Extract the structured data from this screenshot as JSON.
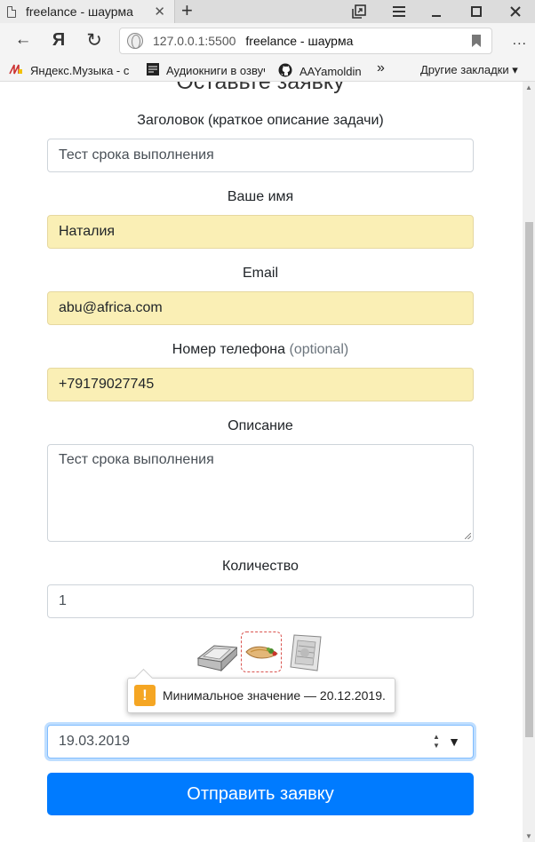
{
  "browser": {
    "tab_title": "freelance - шаурма",
    "new_tab": "+",
    "url": "127.0.0.1:5500",
    "page_title": "freelance - шаурма",
    "back": "←",
    "yandex": "Я",
    "reload": "↻",
    "menu": "..."
  },
  "bookmarks": {
    "items": [
      {
        "label": "Яндекс.Музыка - с",
        "icon": "yandex-music-icon"
      },
      {
        "label": "Аудиокниги в озвуч",
        "icon": "audiobooks-icon"
      },
      {
        "label": "AAYamoldin",
        "icon": "github-icon"
      }
    ],
    "more": "»",
    "other": "Другие закладки ▾"
  },
  "form": {
    "heading": "Оставьте заявку",
    "title_label": "Заголовок (краткое описание задачи)",
    "title_value": "Тест срока выполнения",
    "name_label": "Ваше имя",
    "name_value": "Наталия",
    "email_label": "Email",
    "email_value": "abu@africa.com",
    "phone_label": "Номер телефона",
    "phone_optional": "(optional)",
    "phone_value": "+79179027745",
    "description_label": "Описание",
    "description_value": "Тест срока выполнения",
    "quantity_label": "Количество",
    "quantity_value": "1",
    "products": [
      "container-icon",
      "shawarma-icon",
      "foil-wrap-icon"
    ],
    "selected_product": "shawarma-icon",
    "date_value": "19.03.2019",
    "submit_label": "Отправить заявку"
  },
  "tooltip": {
    "icon": "!",
    "text": "Минимальное значение — 20.12.2019."
  },
  "colors": {
    "primary": "#007bff",
    "autofill": "#faefb5",
    "warning": "#f5a623",
    "selected_border": "#d9534f"
  }
}
